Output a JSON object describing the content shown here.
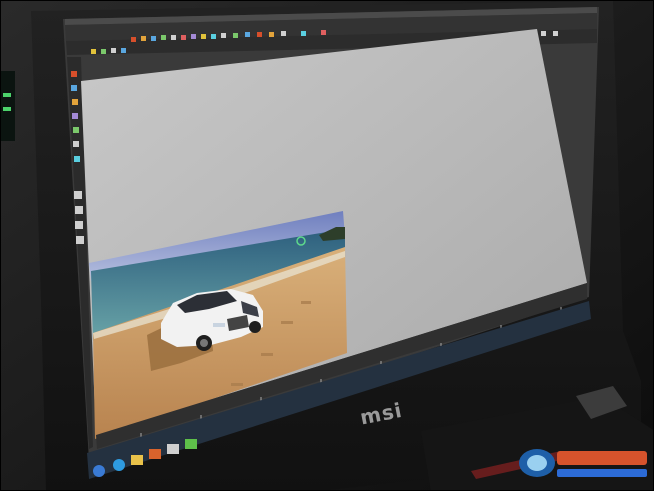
{
  "scene": {
    "description_subject": "laptop-screen-photo",
    "monitor_brand": "msi",
    "app_type": "3d-modeling-software",
    "viewport_content": "white-car-on-beach-render",
    "colors": {
      "bezel": "#1b1b1b",
      "app_chrome": "#3a3a3a",
      "canvas": "#bdbdbd",
      "sky": "#8e9fd1",
      "sea": "#3d7f98",
      "sand": "#c79a63",
      "car": "#f2f2f2",
      "taskbar": "#2a3a4a"
    },
    "icons": [
      "windows-start-icon",
      "ie-icon",
      "folder-icon",
      "media-icon",
      "app-icon-1",
      "app-icon-2"
    ]
  }
}
